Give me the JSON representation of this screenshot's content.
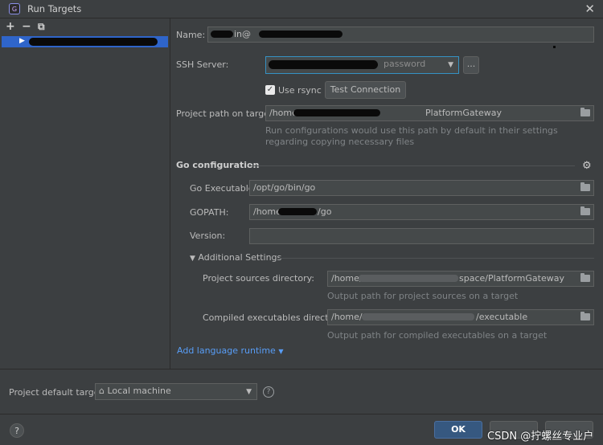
{
  "window": {
    "title": "Run Targets"
  },
  "toolbar": {
    "add": "+",
    "remove": "−",
    "copy": "⧉"
  },
  "form": {
    "name_label": "Name:",
    "name_value_visible": "in@",
    "ssh_label": "SSH Server:",
    "ssh_value_visible": "password",
    "ssh_more": "...",
    "use_rsync_label": "Use rsync",
    "use_rsync_checked": true,
    "test_connection": "Test Connection",
    "project_path_label": "Project path on target:",
    "project_path_value": "/home",
    "project_path_tail": "PlatformGateway",
    "project_path_hint": "Run configurations would use this path by default in their settings regarding copying necessary files"
  },
  "go_config": {
    "section_title": "Go configuration",
    "exe_label": "Go Executable:",
    "exe_value": "/opt/go/bin/go",
    "gopath_label": "GOPATH:",
    "gopath_value": "/home",
    "gopath_tail": "/go",
    "version_label": "Version:",
    "version_value": "",
    "additional_settings": "Additional Settings",
    "src_dir_label": "Project sources directory:",
    "src_dir_value": "/home/",
    "src_dir_tail": "space/PlatformGateway",
    "src_dir_hint": "Output path for project sources on a target",
    "compiled_dir_label": "Compiled executables directory:",
    "compiled_dir_value": "/home/",
    "compiled_dir_tail": "/executable",
    "compiled_dir_hint": "Output path for compiled executables on a target"
  },
  "add_runtime_link": "Add language runtime",
  "default_target": {
    "label": "Project default target:",
    "value": "Local machine"
  },
  "buttons": {
    "help": "?",
    "ok": "OK"
  },
  "watermark": "CSDN @拧螺丝专业户",
  "colors": {
    "accent": "#2f65ca",
    "ok_button": "#365880",
    "link": "#589df6",
    "background": "#3c3f41"
  }
}
